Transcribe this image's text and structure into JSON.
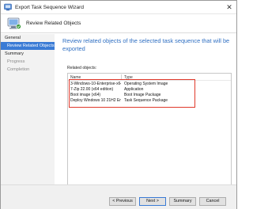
{
  "window": {
    "title": "Export Task Sequence Wizard",
    "close_glyph": "✕"
  },
  "header": {
    "title": "Review Related Objects"
  },
  "sidebar": {
    "items": [
      {
        "label": "General",
        "state": "normal"
      },
      {
        "label": "Review Related Objects",
        "state": "active"
      },
      {
        "label": "Summary",
        "state": "normal"
      },
      {
        "label": "Progress",
        "state": "disabled"
      },
      {
        "label": "Completion",
        "state": "disabled"
      }
    ]
  },
  "content": {
    "heading": "Review related objects of the selected task sequence that will be exported",
    "related_label": "Related objects:",
    "columns": {
      "name": "Name",
      "type": "Type"
    },
    "rows": [
      {
        "name": "3-Windows-10-Enterprise-x64",
        "type": "Operating System Image"
      },
      {
        "name": "7-Zip 22.00 (x64 edition)",
        "type": "Application"
      },
      {
        "name": "Boot image (x64)",
        "type": "Boot Image Package"
      },
      {
        "name": "Deploy Windows 10 21H2 En...",
        "type": "Task Sequence Package"
      }
    ]
  },
  "footer": {
    "prev_label": "< Previous",
    "next_label": "Next >",
    "summary_label": "Summary",
    "cancel_label": "Cancel"
  },
  "colors": {
    "accent": "#3a7bd5",
    "heading": "#2f6fc2",
    "highlight": "#e0392b"
  }
}
